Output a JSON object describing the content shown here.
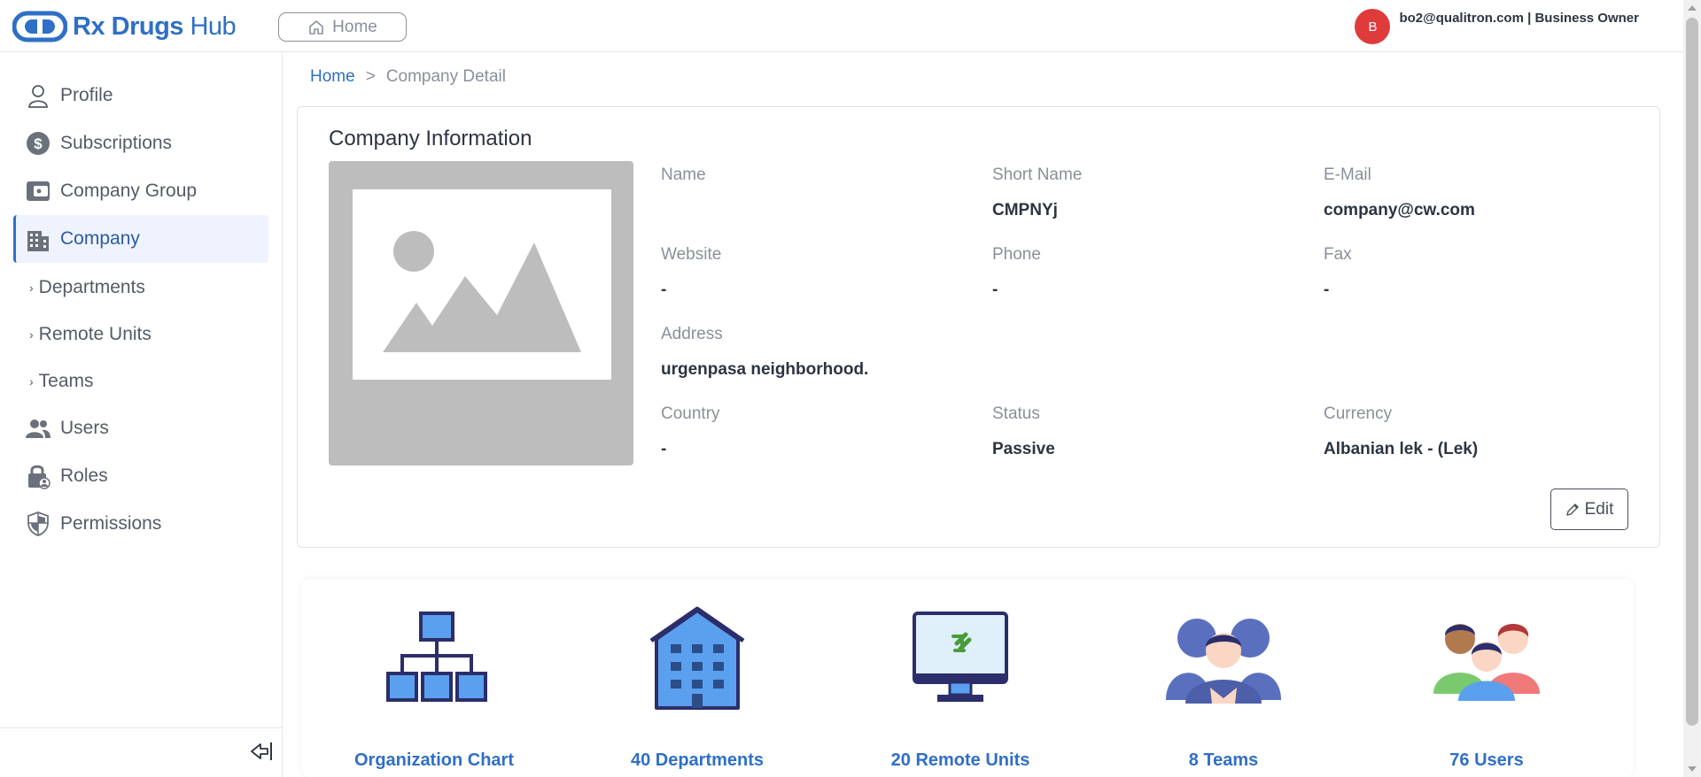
{
  "app": {
    "brand_name_bold": "Rx Drugs",
    "brand_name_thin": "Hub",
    "brand_color": "#2f6fc7"
  },
  "header": {
    "home_label": "Home",
    "avatar_letter": "B",
    "user_label": "bo2@qualitron.com | Business Owner",
    "avatar_color": "#e03b3b"
  },
  "sidebar": {
    "items": [
      {
        "label": "Profile",
        "icon": "user-icon"
      },
      {
        "label": "Subscriptions",
        "icon": "dollar-icon"
      },
      {
        "label": "Company Group",
        "icon": "wallet-icon"
      },
      {
        "label": "Company",
        "icon": "building-icon",
        "active": true
      },
      {
        "label": "Users",
        "icon": "users-icon"
      },
      {
        "label": "Roles",
        "icon": "lock-user-icon"
      },
      {
        "label": "Permissions",
        "icon": "shield-icon"
      }
    ],
    "sub_items": [
      {
        "label": "Departments"
      },
      {
        "label": "Remote Units"
      },
      {
        "label": "Teams"
      }
    ]
  },
  "breadcrumb": {
    "home": "Home",
    "separator": ">",
    "current": "Company Detail"
  },
  "company": {
    "section_title": "Company Information",
    "fields": {
      "name": {
        "label": "Name",
        "value": ""
      },
      "short_name": {
        "label": "Short Name",
        "value": "CMPNYj"
      },
      "email": {
        "label": "E-Mail",
        "value": "company@cw.com"
      },
      "website": {
        "label": "Website",
        "value": "-"
      },
      "phone": {
        "label": "Phone",
        "value": "-"
      },
      "fax": {
        "label": "Fax",
        "value": "-"
      },
      "address": {
        "label": "Address",
        "value": "urgenpasa neighborhood."
      },
      "country": {
        "label": "Country",
        "value": "-"
      },
      "status": {
        "label": "Status",
        "value": "Passive"
      },
      "currency": {
        "label": "Currency",
        "value": "Albanian lek - (Lek)"
      }
    },
    "edit_label": "Edit"
  },
  "tiles": [
    {
      "label": "Organization Chart",
      "icon": "org-chart-icon"
    },
    {
      "label": "40 Departments",
      "icon": "building-icon"
    },
    {
      "label": "20 Remote Units",
      "icon": "remote-monitor-icon"
    },
    {
      "label": "8 Teams",
      "icon": "team-icon"
    },
    {
      "label": "76 Users",
      "icon": "users-group-icon"
    }
  ]
}
